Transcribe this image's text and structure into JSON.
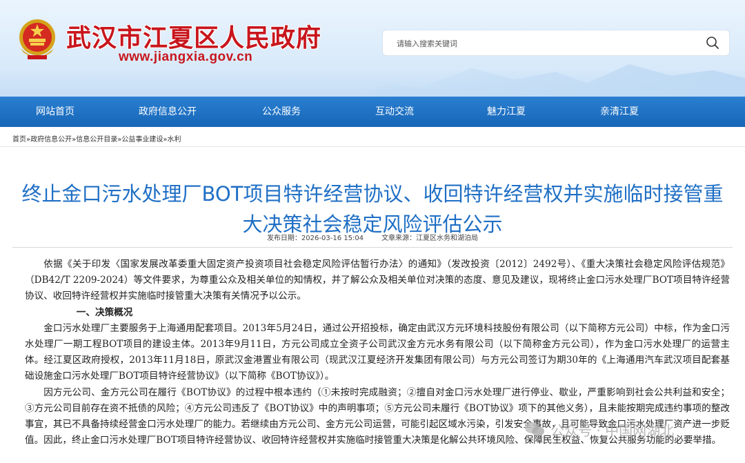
{
  "header": {
    "site_title": "武汉市江夏区人民政府",
    "site_url": "www.jiangxia.gov.cn",
    "search_placeholder": "请输入搜索关键词"
  },
  "nav": {
    "items": [
      {
        "label": "网站首页"
      },
      {
        "label": "政府信息公开"
      },
      {
        "label": "公众服务"
      },
      {
        "label": "互动交流"
      },
      {
        "label": "魅力江夏"
      },
      {
        "label": "亲清江夏"
      }
    ]
  },
  "breadcrumb": [
    "首页",
    "政府信息公开",
    "信息公开目录",
    "公益事业建设",
    "水利"
  ],
  "breadcrumb_sep": "»",
  "article": {
    "title": "终止金口污水处理厂BOT项目特许经营协议、收回特许经营权并实施临时接管重大决策社会稳定风险评估公示",
    "publish_date": "发布日期：2026-03-16 15:04",
    "source": "文章来源：江夏区水务和湖泊局",
    "paragraphs": [
      "依据《关于印发〈国家发展改革委重大固定资产投资项目社会稳定风险评估暂行办法〉的通知》（发改投资〔2012〕2492号）、《重大决策社会稳定风险评估规范》（DB42/T 2209-2024）等文件要求，为尊重公众及相关单位的知情权，并了解公众及相关单位对决策的态度、意见及建议，现将终止金口污水处理厂BOT项目特许经营协议、收回特许经营权并实施临时接管重大决策有关情况予以公示。",
      "一、决策概况",
      "金口污水处理厂主要服务于上海通用配套项目。2013年5月24日，通过公开招投标，确定由武汉方元环境科技股份有限公司（以下简称方元公司）中标，作为金口污水处理厂一期工程BOT项目的建设主体。2013年9月11日，方元公司成立全资子公司武汉金方元水务有限公司（以下简称金方元公司），作为金口污水处理厂的运营主体。经江夏区政府授权，2013年11月18日，原武汉金港置业有限公司（现武汉江夏经济开发集团有限公司）与方元公司签订为期30年的《上海通用汽车武汉项目配套基础设施金口污水处理厂BOT项目特许经营协议》（以下简称《BOT协议》）。",
      "因方元公司、金方元公司在履行《BOT协议》的过程中根本违约（①未按时完成融资；②擅自对金口污水处理厂进行停业、歇业，严重影响到社会公共利益和安全；③方元公司目前存在资不抵债的风险；④方元公司违反了《BOT协议》中的声明事项；⑤方元公司未履行《BOT协议》项下的其他义务），且未能按期完成违约事项的整改事宜，其已不具备持续经营金口污水处理厂的能力。若继续由方元公司、金方元公司运营，可能引起区域水污染，引发安全事故，且可能导致金口污水处理厂资产进一步贬值。因此，终止金口污水处理厂BOT项目特许经营协议、收回特许经营权并实施临时接管重大决策是化解公共环境风险、保障民生权益、恢复公共服务功能的必要举措。"
    ]
  },
  "watermark": "公众号 · 中国网湖北",
  "colors": {
    "brand_red": "#c8161d",
    "nav_blue": "#1766b8",
    "title_blue": "#1f6fc5"
  }
}
